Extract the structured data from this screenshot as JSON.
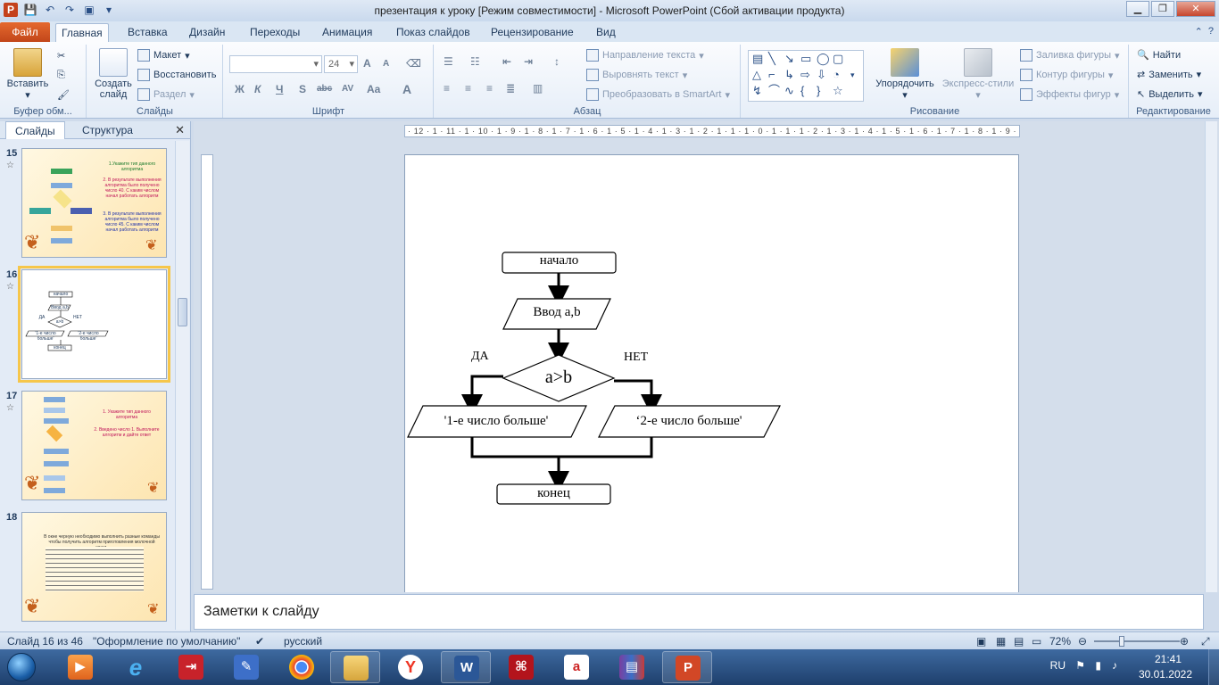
{
  "window": {
    "title": "презентация к уроку [Режим совместимости]  -  Microsoft PowerPoint (Сбой активации продукта)",
    "app_logo": "P",
    "minimize": "▁",
    "restore": "❐",
    "close": "✕"
  },
  "tabs": {
    "file": "Файл",
    "items": [
      "Главная",
      "Вставка",
      "Дизайн",
      "Переходы",
      "Анимация",
      "Показ слайдов",
      "Рецензирование",
      "Вид"
    ],
    "active": "Главная"
  },
  "ribbon": {
    "clipboard": {
      "paste": "Вставить",
      "label": "Буфер обм..."
    },
    "slides": {
      "new_slide": "Создать слайд",
      "layout": "Макет",
      "reset": "Восстановить",
      "section": "Раздел",
      "label": "Слайды"
    },
    "font": {
      "font_name": "",
      "font_size": "24",
      "label": "Шрифт",
      "bold": "Ж",
      "italic": "К",
      "underline": "Ч",
      "shadow": "S",
      "strike": "abc",
      "spacing": "AV",
      "case": "Aa",
      "color": "A",
      "grow": "A",
      "shrink": "A"
    },
    "paragraph": {
      "direction": "Направление текста",
      "align": "Выровнять текст",
      "smartart": "Преобразовать в SmartArt",
      "label": "Абзац"
    },
    "drawing": {
      "arrange": "Упорядочить",
      "styles": "Экспресс-стили",
      "fill": "Заливка фигуры",
      "outline": "Контур фигуры",
      "effects": "Эффекты фигур",
      "label": "Рисование"
    },
    "editing": {
      "find": "Найти",
      "replace": "Заменить",
      "select": "Выделить",
      "label": "Редактирование"
    }
  },
  "sidepane": {
    "tab_slides": "Слайды",
    "tab_outline": "Структура",
    "close": "✕",
    "thumbs": [
      {
        "num": "15",
        "texts": [
          "1.Укажите тип данного алгоритма",
          "2. В результате выполнения алгоритма было получено число 40. С каким числом начал работать алгоритм",
          "3. В результате выполнения алгоритма было получено число 45. С каким числом начал работать алгоритм"
        ]
      },
      {
        "num": "16",
        "texts": [
          "начало",
          "Ввод a,b",
          "ДА",
          "НЕТ",
          "a>b",
          "'1-е число больше'",
          "'2-е число больше'",
          "конец"
        ]
      },
      {
        "num": "17",
        "texts": [
          "1. Укажите тип данного алгоритма",
          "2. Введено число 1. Выполните алгоритм и дайте ответ"
        ]
      },
      {
        "num": "18",
        "texts": [
          "В окне черную необходимо выполнить разные команды чтобы получить алгоритм приготовления молочной каши."
        ]
      }
    ]
  },
  "slide": {
    "start": "начало",
    "input": "Ввод a,b",
    "condition": "a>b",
    "yes": "ДА",
    "no": "НЕТ",
    "out_left": "'1-е число  больше'",
    "out_right": "‘2-е число больше'",
    "end": "конец"
  },
  "ruler": {
    "h_ticks": "· 12 · 1 · 11 · 1 · 10 · 1 · 9 · 1 · 8 · 1 · 7 · 1 · 6 · 1 · 5 · 1 · 4 · 1 · 3 · 1 · 2 · 1 · 1 · 1 · 0 · 1 · 1 · 1 · 2 · 1 · 3 · 1 · 4 · 1 · 5 · 1 · 6 · 1 · 7 · 1 · 8 · 1 · 9 · 1 · 10 · 1 · 11 · 1 · 12 ·"
  },
  "notes": {
    "placeholder": "Заметки к слайду"
  },
  "status": {
    "slide_info": "Слайд 16 из 46",
    "theme": "\"Оформление по умолчанию\"",
    "language": "русский",
    "zoom": "72%"
  },
  "taskbar": {
    "lang": "RU",
    "time": "21:41",
    "date": "30.01.2022"
  },
  "colors": {
    "file_tab": "#d3531f",
    "ribbon_bg": "#f3f7fc",
    "taskbar": "#2a5286",
    "selection": "#f6c64a"
  }
}
